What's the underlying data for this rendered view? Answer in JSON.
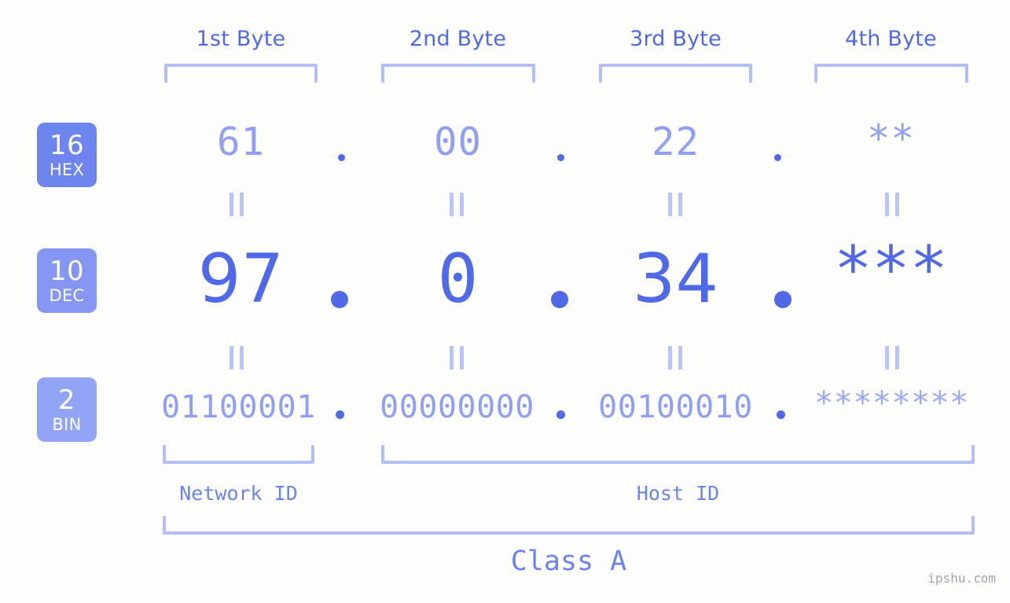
{
  "background_color": "#fdfefb",
  "colors": {
    "accent_strong": "#4f69e8",
    "accent_light": "#8f9ff5",
    "bracket": "#b3bffa",
    "badge_hex": "#6e84ef",
    "badge_dec": "#8596f2",
    "badge_bin": "#91a4f6",
    "watermark": "#9ba6b8"
  },
  "byte_headers": [
    {
      "label": "1st Byte"
    },
    {
      "label": "2nd Byte"
    },
    {
      "label": "3rd Byte"
    },
    {
      "label": "4th Byte"
    }
  ],
  "bases": [
    {
      "num": "16",
      "label": "HEX"
    },
    {
      "num": "10",
      "label": "DEC"
    },
    {
      "num": "2",
      "label": "BIN"
    }
  ],
  "rows": {
    "hex": {
      "values": [
        "61",
        "00",
        "22",
        "**"
      ],
      "separator": "."
    },
    "dec": {
      "values": [
        "97",
        "0",
        "34",
        "***"
      ],
      "separator": "."
    },
    "bin": {
      "values": [
        "01100001",
        "00000000",
        "00100010",
        "********"
      ],
      "separator": "."
    }
  },
  "equivalence_symbol": "=",
  "segments": {
    "network_id": "Network ID",
    "host_id": "Host ID"
  },
  "class_label": "Class A",
  "watermark": "ipshu.com"
}
